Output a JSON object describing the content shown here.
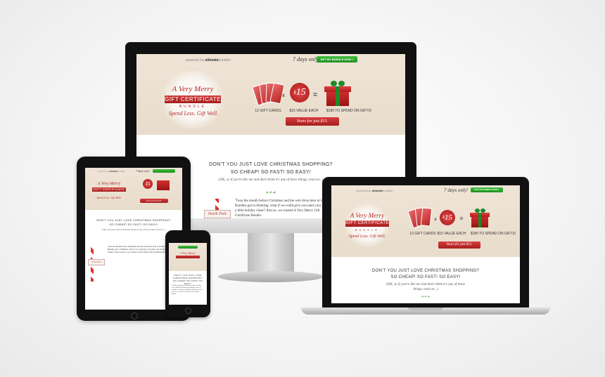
{
  "site": {
    "powered_by": "powered by",
    "brand_bold": "ultimate",
    "brand_light": "bundles",
    "days": "7 days only!",
    "cta": "GET MY BUNDLE NOW »",
    "logo_script": "A Very Merry",
    "logo_ribbon": "GIFT CERTIFICATE",
    "logo_bundle": "BUNDLE",
    "tagline": "Spend Less. Gift Well.",
    "times": "x",
    "equals": "=",
    "price_dollar": "$",
    "price_value": "15",
    "captions": [
      "12 GIFT CARDS",
      "$15 VALUE EACH",
      "$180 TO SPEND ON GIFTS!"
    ],
    "pill": "Yours for just $15.",
    "headline_1": "DON'T YOU JUST LOVE CHRISTMAS SHOPPING?",
    "headline_2": "SO CHEAP! SO FAST! SO EASY!",
    "sub": "(OK, so if you're like me and don't think it's any of these things, read on...)",
    "flourish": "❧✦☙",
    "sign": "North Pole",
    "body_1": "'Twas the month before Christmas and the web divas here at Ultimate Bundles got to thinking: what if we could give you (and your budget) a little holiday cheer? And so, we created A Very Merry Gift Certificate Bundle.",
    "body_2": "It's like having Santa's little helper as your personal assistant. For"
  },
  "phone": {
    "headline": "DON'T YOU JUST LOVE CHRISTMAS SHOPPING? SO CHEAP! SO FAST! SO EASY!"
  },
  "colors": {
    "accent_red": "#b52a2a",
    "cta_green": "#2aa52a",
    "hero_bg": "#ece1d2"
  }
}
